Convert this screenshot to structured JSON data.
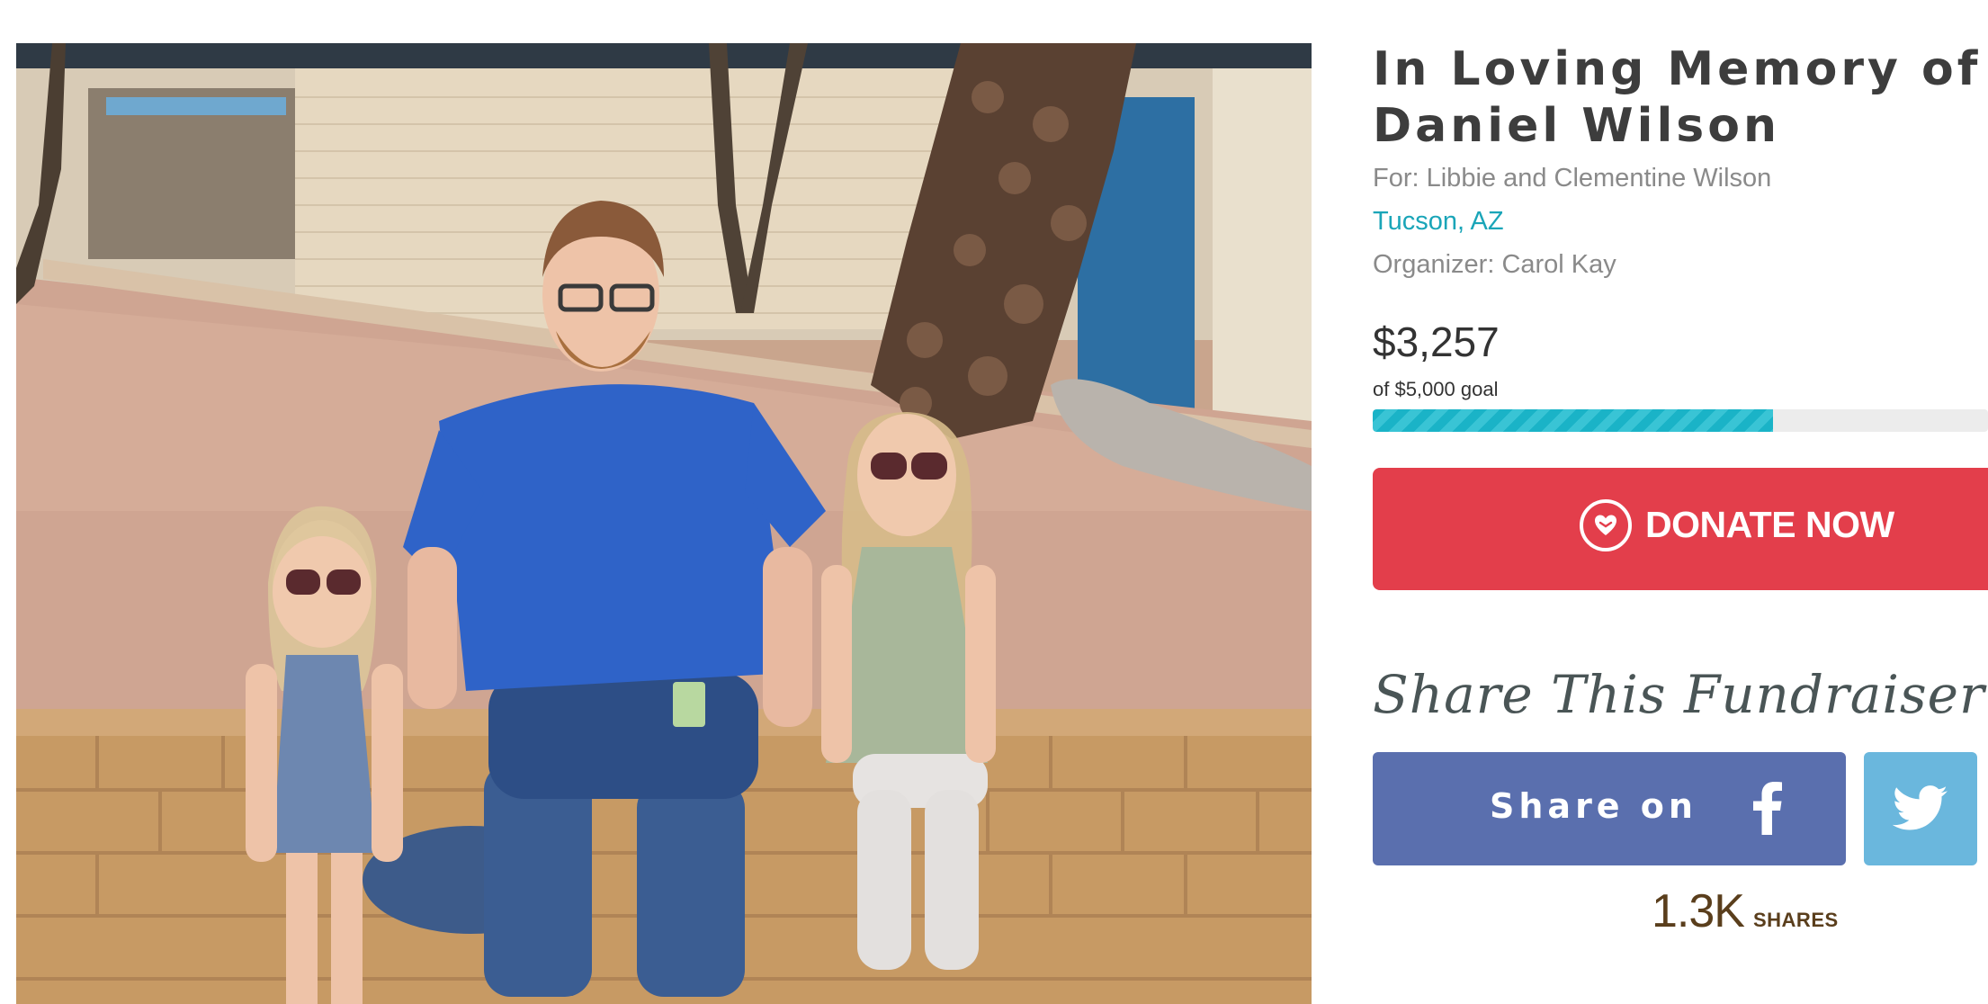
{
  "campaign": {
    "title": "In Loving Memory of Daniel Wilson",
    "beneficiary": "For: Libbie and Clementine Wilson",
    "location": "Tucson, AZ",
    "organizer": "Organizer: Carol Kay"
  },
  "funding": {
    "raised": "$3,257",
    "goal_text": "of $5,000 goal",
    "progress_fraction": 0.65
  },
  "donate": {
    "label": "DONATE NOW",
    "icon": "heart-hand-icon"
  },
  "share": {
    "heading": "Share This Fundraiser",
    "facebook_label": "Share on",
    "facebook_icon": "facebook-f-icon",
    "twitter_icon": "twitter-bird-icon",
    "count": "1.3K",
    "count_label": "SHARES"
  },
  "colors": {
    "accent_teal": "#1aa5b8",
    "donate_red": "#e33e4b",
    "facebook_blue": "#5a6fae",
    "twitter_blue": "#6ab7dd",
    "title_text": "#3d3d3d",
    "muted_text": "#8a8a8a",
    "shares_brown": "#5a3e1c"
  }
}
